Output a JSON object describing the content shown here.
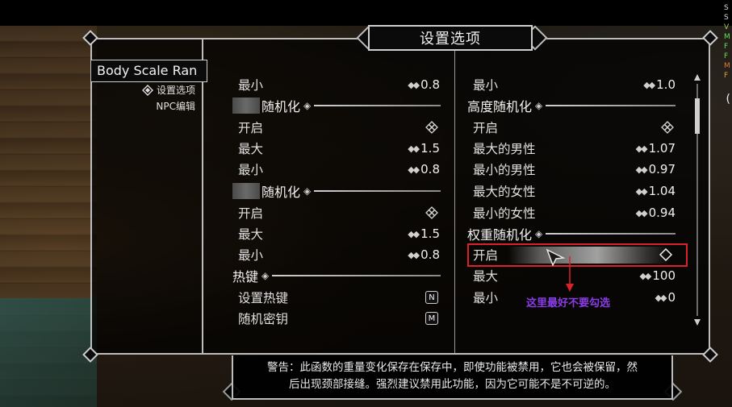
{
  "menu": {
    "title": "设置选项",
    "mod_name": "Body Scale Ran",
    "nav": [
      {
        "label": "设置选项",
        "icon": "mcm-diamond-icon"
      },
      {
        "label": "NPC编辑"
      }
    ]
  },
  "left_column": {
    "row_min_1": {
      "label": "最小",
      "value": "0.8"
    },
    "section_1": {
      "label": "随机化"
    },
    "row_enable_1": {
      "label": "开启",
      "checked": true
    },
    "row_max_2": {
      "label": "最大",
      "value": "1.5"
    },
    "row_min_2": {
      "label": "最小",
      "value": "0.8"
    },
    "section_2": {
      "label": "随机化"
    },
    "row_enable_2": {
      "label": "开启",
      "checked": true
    },
    "row_max_3": {
      "label": "最大",
      "value": "1.5"
    },
    "row_min_3": {
      "label": "最小",
      "value": "0.8"
    },
    "section_hotkeys": {
      "label": "热键"
    },
    "row_set_hotkey": {
      "label": "设置热键",
      "key": "N"
    },
    "row_random_key": {
      "label": "随机密钥",
      "key": "M"
    }
  },
  "right_column": {
    "row_min_top": {
      "label": "最小",
      "value": "1.0"
    },
    "section_height": {
      "label": "高度随机化"
    },
    "row_enable_height": {
      "label": "开启",
      "checked": true
    },
    "row_max_male": {
      "label": "最大的男性",
      "value": "1.07"
    },
    "row_min_male": {
      "label": "最小的男性",
      "value": "0.97"
    },
    "row_max_female": {
      "label": "最大的女性",
      "value": "1.04"
    },
    "row_min_female": {
      "label": "最小的女性",
      "value": "0.94"
    },
    "section_weight": {
      "label": "权重随机化"
    },
    "row_enable_weight": {
      "label": "开启",
      "checked": false
    },
    "row_max_weight": {
      "label": "最大",
      "value": "100"
    },
    "row_min_weight": {
      "label": "最小",
      "value": "0"
    }
  },
  "annotation": "这里最好不要勾选",
  "info_text": {
    "line1": "警告：此函数的重量变化保存在保存中，即使功能被禁用，它也会被保留，然",
    "line2": "后出现颈部接缝。强烈建议禁用此功能，因为它可能不是不可逆的。"
  },
  "colors": {
    "highlight_border": "#d8232a",
    "annotation": "#8a3ce8",
    "frame": "#bdbdbd"
  }
}
